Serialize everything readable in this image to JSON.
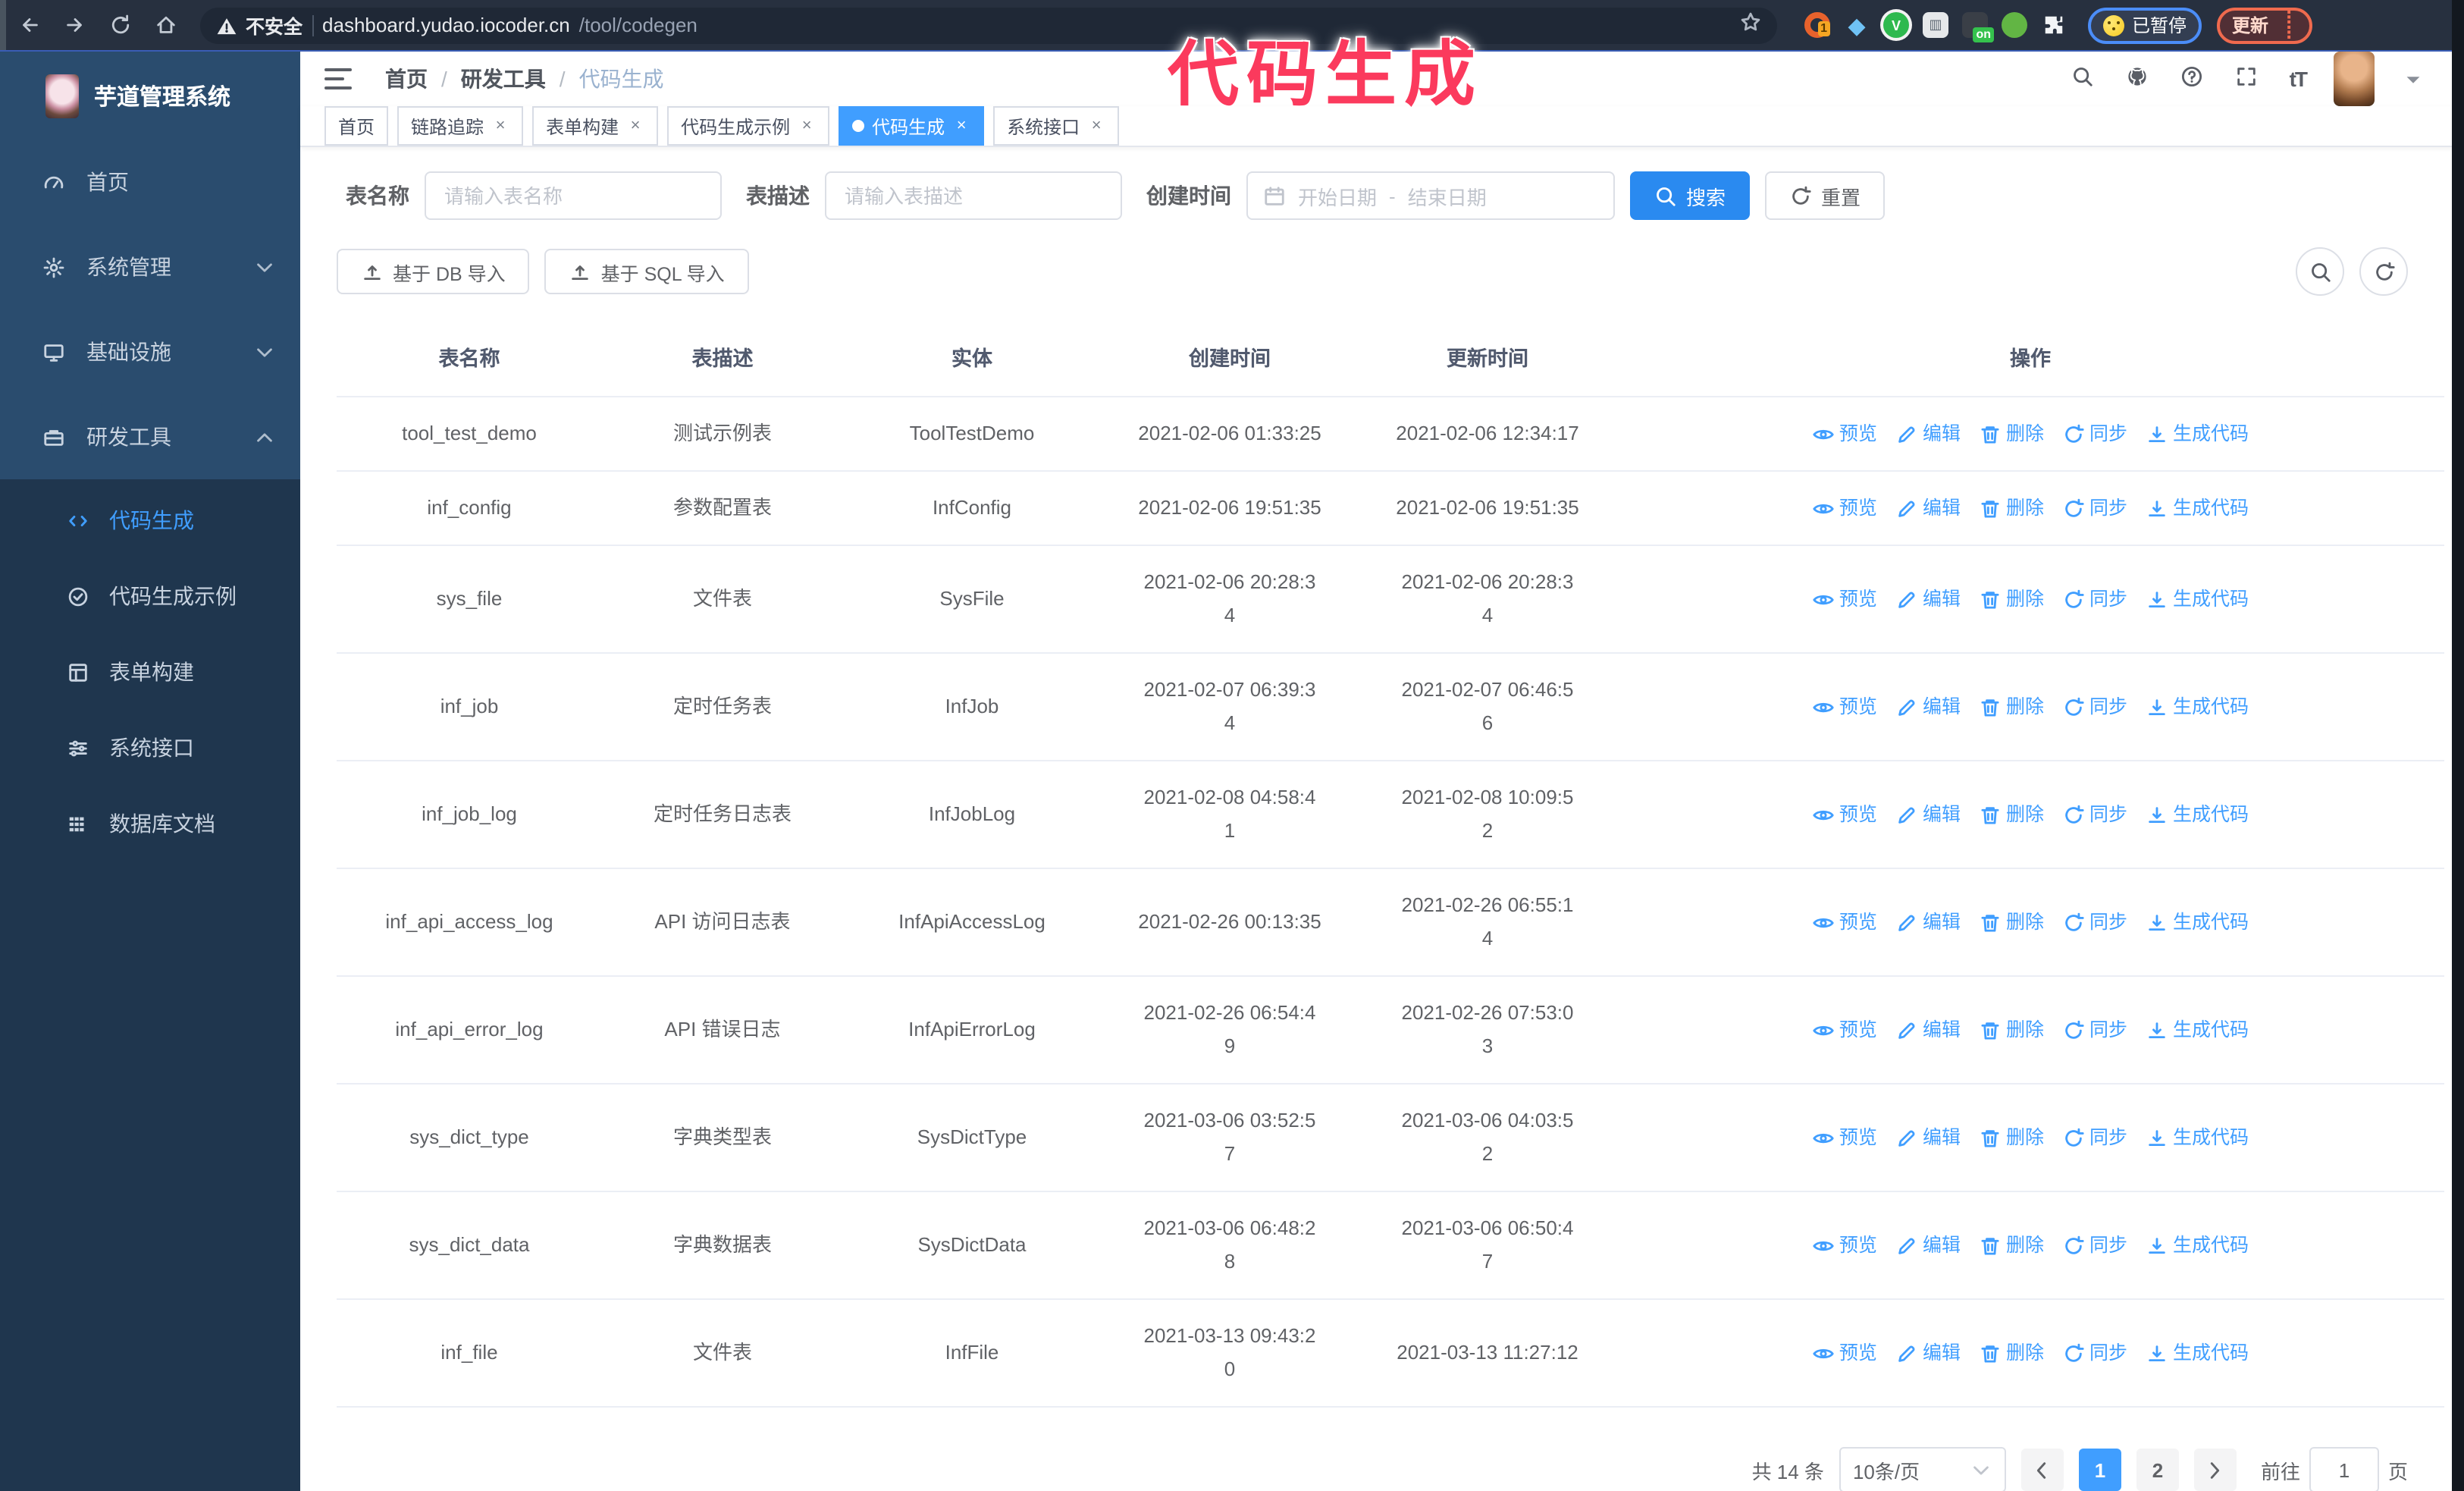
{
  "browser": {
    "security_label": "不安全",
    "url_host": "dashboard.yudao.iocoder.cn",
    "url_path": "/tool/codegen",
    "ext_badge_1": "1",
    "ext_badge_on": "on",
    "paused_label": "已暂停",
    "update_label": "更新"
  },
  "sidebar": {
    "title": "芋道管理系统",
    "items": [
      {
        "label": "首页"
      },
      {
        "label": "系统管理"
      },
      {
        "label": "基础设施"
      },
      {
        "label": "研发工具"
      }
    ],
    "subitems": [
      {
        "label": "代码生成"
      },
      {
        "label": "代码生成示例"
      },
      {
        "label": "表单构建"
      },
      {
        "label": "系统接口"
      },
      {
        "label": "数据库文档"
      }
    ]
  },
  "breadcrumb": [
    "首页",
    "研发工具",
    "代码生成"
  ],
  "tabs": [
    {
      "label": "首页"
    },
    {
      "label": "链路追踪"
    },
    {
      "label": "表单构建"
    },
    {
      "label": "代码生成示例"
    },
    {
      "label": "代码生成"
    },
    {
      "label": "系统接口"
    }
  ],
  "filters": {
    "name_label": "表名称",
    "name_placeholder": "请输入表名称",
    "desc_label": "表描述",
    "desc_placeholder": "请输入表描述",
    "created_label": "创建时间",
    "start_placeholder": "开始日期",
    "range_separator": "-",
    "end_placeholder": "结束日期",
    "search_label": "搜索",
    "reset_label": "重置"
  },
  "import_bar": {
    "db": "基于 DB 导入",
    "sql": "基于 SQL 导入"
  },
  "table": {
    "headers": [
      "表名称",
      "表描述",
      "实体",
      "创建时间",
      "更新时间",
      "操作"
    ],
    "action_labels": [
      "预览",
      "编辑",
      "删除",
      "同步",
      "生成代码"
    ],
    "rows": [
      {
        "name": "tool_test_demo",
        "desc": "测试示例表",
        "entity": "ToolTestDemo",
        "created": "2021-02-06 01:33:25",
        "updated": "2021-02-06 12:34:17"
      },
      {
        "name": "inf_config",
        "desc": "参数配置表",
        "entity": "InfConfig",
        "created": "2021-02-06 19:51:35",
        "updated": "2021-02-06 19:51:35"
      },
      {
        "name": "sys_file",
        "desc": "文件表",
        "entity": "SysFile",
        "created": "2021-02-06 20:28:3\n4",
        "updated": "2021-02-06 20:28:3\n4"
      },
      {
        "name": "inf_job",
        "desc": "定时任务表",
        "entity": "InfJob",
        "created": "2021-02-07 06:39:3\n4",
        "updated": "2021-02-07 06:46:5\n6"
      },
      {
        "name": "inf_job_log",
        "desc": "定时任务日志表",
        "entity": "InfJobLog",
        "created": "2021-02-08 04:58:4\n1",
        "updated": "2021-02-08 10:09:5\n2"
      },
      {
        "name": "inf_api_access_log",
        "desc": "API 访问日志表",
        "entity": "InfApiAccessLog",
        "created": "2021-02-26 00:13:35",
        "updated": "2021-02-26 06:55:1\n4"
      },
      {
        "name": "inf_api_error_log",
        "desc": "API 错误日志",
        "entity": "InfApiErrorLog",
        "created": "2021-02-26 06:54:4\n9",
        "updated": "2021-02-26 07:53:0\n3"
      },
      {
        "name": "sys_dict_type",
        "desc": "字典类型表",
        "entity": "SysDictType",
        "created": "2021-03-06 03:52:5\n7",
        "updated": "2021-03-06 04:03:5\n2"
      },
      {
        "name": "sys_dict_data",
        "desc": "字典数据表",
        "entity": "SysDictData",
        "created": "2021-03-06 06:48:2\n8",
        "updated": "2021-03-06 06:50:4\n7"
      },
      {
        "name": "inf_file",
        "desc": "文件表",
        "entity": "InfFile",
        "created": "2021-03-13 09:43:2\n0",
        "updated": "2021-03-13 11:27:12"
      }
    ]
  },
  "pagination": {
    "total": "共 14 条",
    "page_size": "10条/页",
    "pages": [
      "1",
      "2"
    ],
    "goto_label": "前往",
    "goto_value": "1",
    "page_suffix": "页"
  },
  "annotation": "代码生成",
  "colors": {
    "accent": "#409eff",
    "annotation": "#fb3a5d",
    "sidebar": "#2a4c6e",
    "submenu": "#1f364e"
  }
}
